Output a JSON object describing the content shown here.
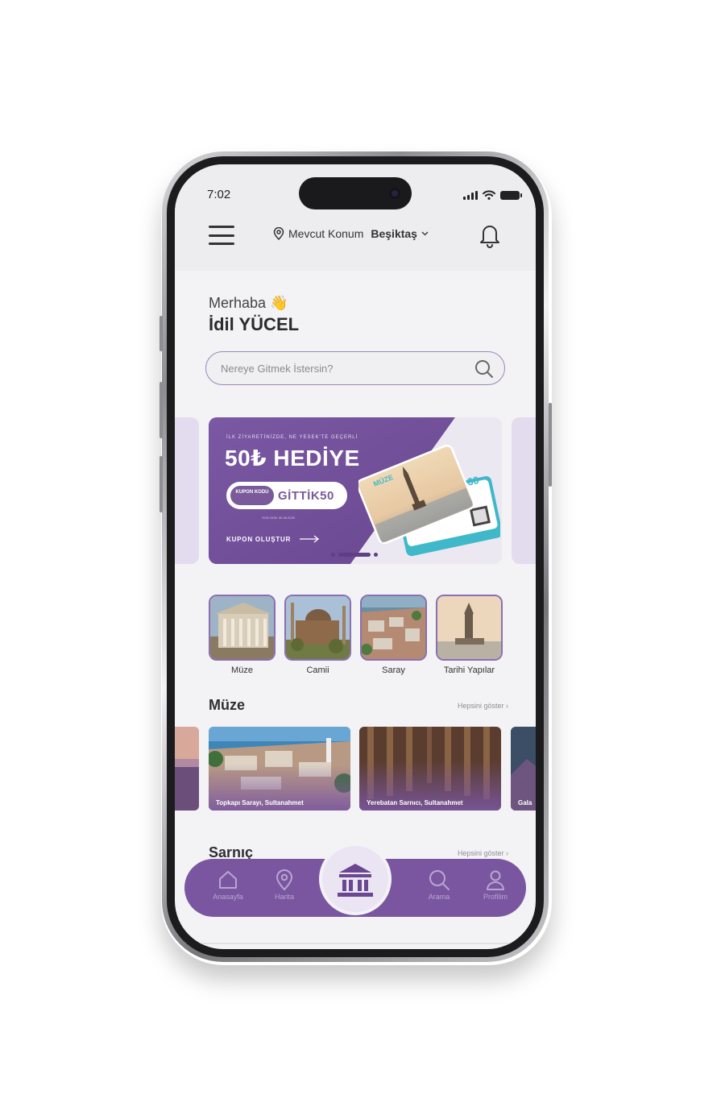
{
  "status_bar": {
    "time": "7:02"
  },
  "header": {
    "location_label": "Mevcut Konum",
    "location_value": "Beşiktaş"
  },
  "greeting": {
    "hello": "Merhaba 👋",
    "name": "İdil YÜCEL"
  },
  "search": {
    "placeholder": "Nereye Gitmek İstersin?"
  },
  "banner": {
    "small_text": "İLK ZİYARETİNİZDE, NE YESEK'TE GEÇERLİ",
    "title": "50₺ HEDİYE",
    "coupon_label": "KUPON KODU",
    "coupon_code": "GİTTİK50",
    "date": "SON GÜN: 30.06.2025",
    "cta": "KUPON OLUŞTUR",
    "card_front_text": "MÜZE",
    "card_back_text": "60",
    "slide_count": 3,
    "active_slide": 2
  },
  "categories": [
    {
      "label": "Müze"
    },
    {
      "label": "Camii"
    },
    {
      "label": "Saray"
    },
    {
      "label": "Tarihi Yapılar"
    }
  ],
  "section_museum": {
    "title": "Müze",
    "see_all": "Hepsini göster ›",
    "items": [
      {
        "label": "Topkapı Sarayı, Sultanahmet"
      },
      {
        "label": "Yerebatan Sarnıcı, Sultanahmet"
      },
      {
        "label": "Gala"
      }
    ]
  },
  "section_cistern": {
    "title": "Sarnıç",
    "see_all": "Hepsini göster ›"
  },
  "nav": {
    "home": "Anasayfa",
    "map": "Harita",
    "search": "Arama",
    "profile": "Profilim"
  },
  "colors": {
    "primary": "#7a56a1",
    "primary_dark": "#6a4790",
    "light_lavender": "#e3dcef",
    "background": "#f3f2f5"
  }
}
